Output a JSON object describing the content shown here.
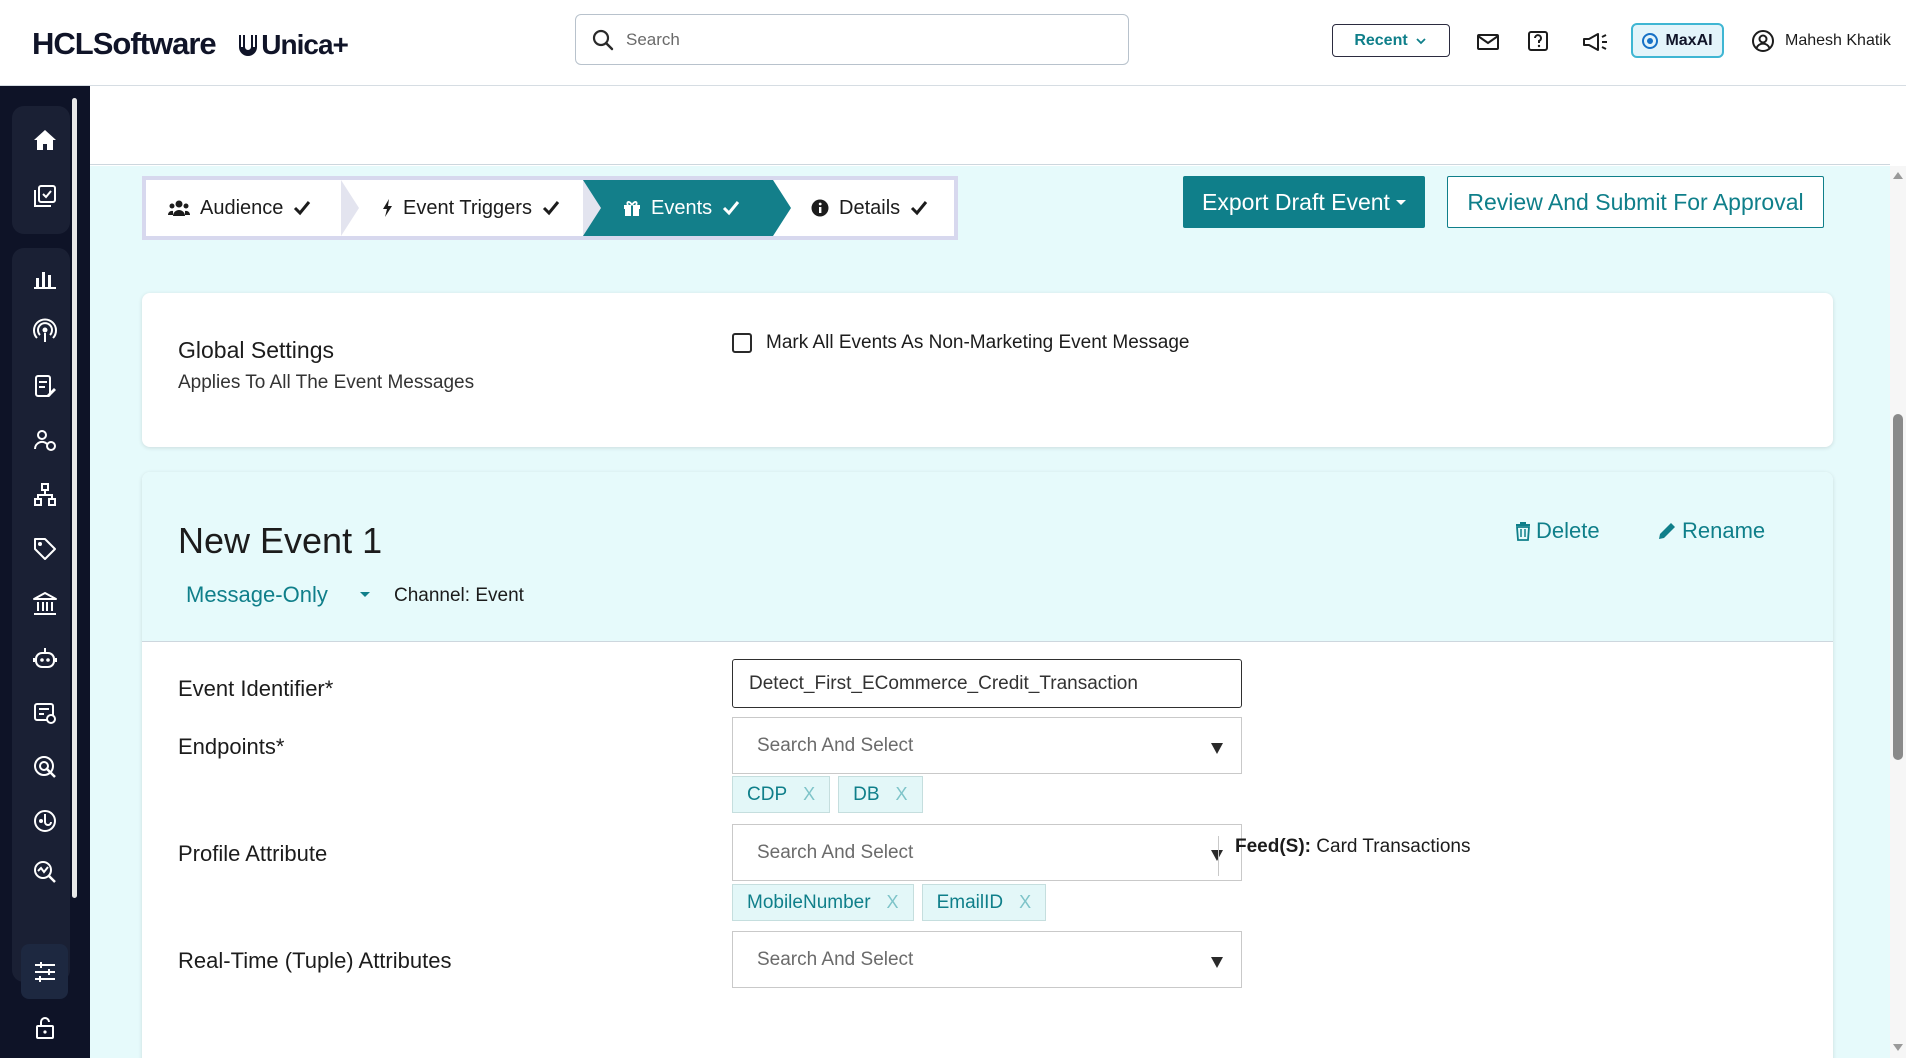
{
  "header": {
    "brand": "HCLSoftware",
    "product": "Unica+",
    "search_placeholder": "Search",
    "recent_label": "Recent",
    "maxai_label": "MaxAI",
    "user_name": "Mahesh Khatik"
  },
  "stepper": {
    "steps": [
      {
        "label": "Audience",
        "icon": "users-icon"
      },
      {
        "label": "Event Triggers",
        "icon": "bolt-icon"
      },
      {
        "label": "Events",
        "icon": "gift-icon"
      },
      {
        "label": "Details",
        "icon": "info-icon"
      }
    ],
    "active_index": 2
  },
  "actions": {
    "export_label": "Export Draft Event",
    "review_label": "Review And Submit For Approval"
  },
  "global_settings": {
    "title": "Global Settings",
    "subtitle": "Applies To All The Event Messages",
    "checkbox_label": "Mark All Events As Non-Marketing Event Message"
  },
  "event": {
    "title": "New Event 1",
    "type": "Message-Only",
    "channel": "Channel: Event",
    "delete_label": "Delete",
    "rename_label": "Rename",
    "identifier_label": "Event Identifier*",
    "identifier_value": "Detect_First_ECommerce_Credit_Transaction",
    "endpoints_label": "Endpoints*",
    "endpoints_placeholder": "Search And Select",
    "endpoints": [
      "CDP",
      "DB"
    ],
    "profile_label": "Profile Attribute",
    "profile_placeholder": "Search And Select",
    "profile_attributes": [
      "MobileNumber",
      "EmailID"
    ],
    "realtime_label": "Real-Time (Tuple) Attributes",
    "realtime_placeholder": "Search And Select",
    "feed_label": "Feed(S):",
    "feed_value": "Card Transactions"
  },
  "chip_remove": "X",
  "colors": {
    "accent": "#0f7f8a",
    "sidebar": "#0e1327",
    "panel": "#e6fafb"
  }
}
